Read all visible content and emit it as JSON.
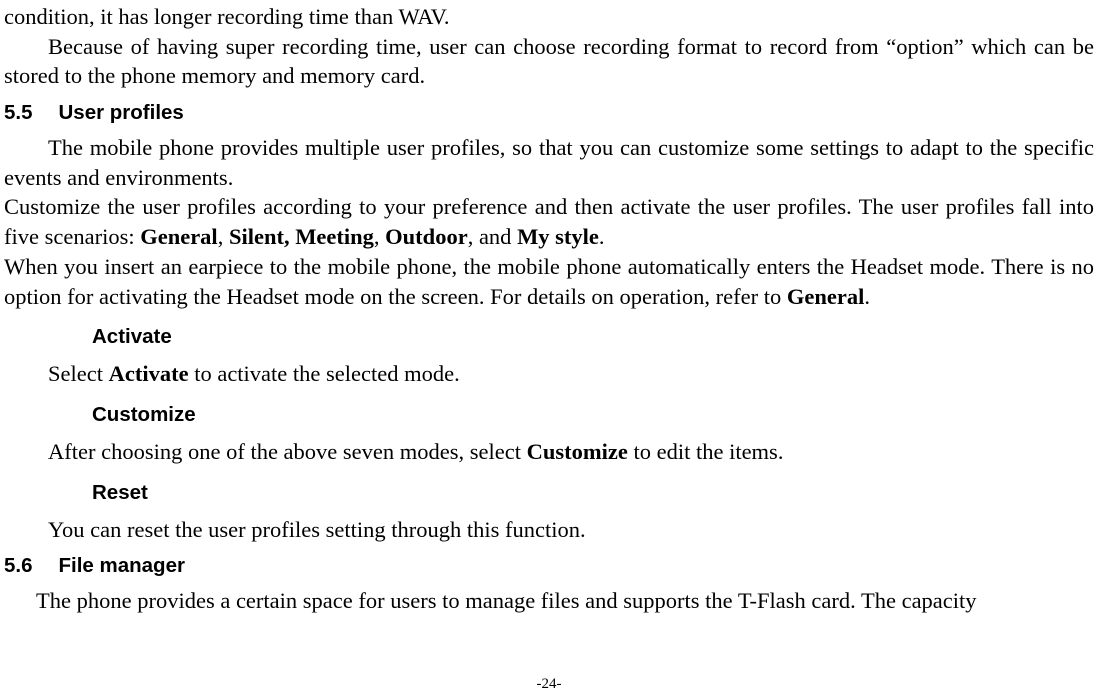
{
  "para1": "condition, it has longer recording time than WAV.",
  "para2": "Because of having super recording time, user can choose recording format to record from “option” which can be stored to the phone memory and memory card.",
  "sec55_num": "5.5",
  "sec55_title": "User profiles",
  "para3": "The mobile phone provides multiple user profiles, so that you can customize some settings to adapt to the specific events and environments.",
  "para4_pre": "Customize the user profiles according to your preference and then activate the user profiles. The user profiles fall into five scenarios: ",
  "bold_general": "General",
  "sep1": ", ",
  "bold_silent_meeting": "Silent, Meeting",
  "sep2": ", ",
  "bold_outdoor": "Outdoor",
  "sep3": ", and ",
  "bold_mystyle": "My style",
  "dot1": ".",
  "para5_pre": "When you insert an earpiece to the mobile phone, the mobile phone automatically enters the Headset mode. There is no option for activating the Headset mode on the screen. For details on operation, refer to ",
  "bold_general2": "General",
  "dot2": ".",
  "sub_activate": "Activate",
  "para6_pre": "Select ",
  "bold_activate": "Activate",
  "para6_post": " to activate the selected mode.",
  "sub_customize": "Customize",
  "para7_pre": "After choosing one of the above seven modes, select ",
  "bold_customize": "Customize",
  "para7_post": " to edit the items.",
  "sub_reset": "Reset",
  "para8": "You can reset the user profiles setting through this function.",
  "sec56_num": "5.6",
  "sec56_title": "File manager",
  "para9": "The phone provides a certain space for users to manage files and supports the T-Flash card. The capacity",
  "pagenum": "-24-"
}
